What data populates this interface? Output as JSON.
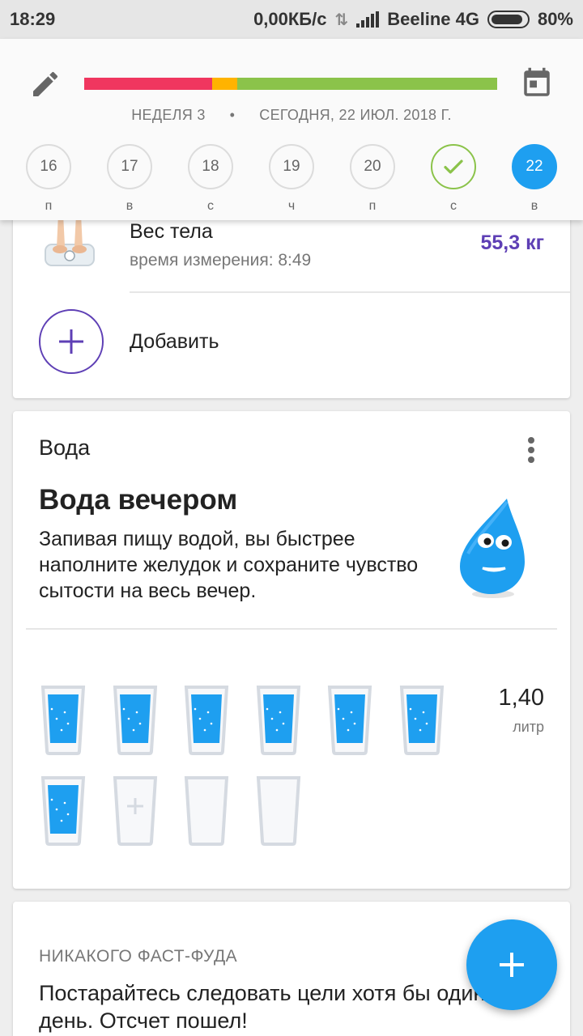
{
  "status_bar": {
    "time": "18:29",
    "net_speed": "0,00КБ/с",
    "carrier": "Beeline 4G",
    "battery": "80%"
  },
  "header": {
    "progress_segments": [
      {
        "fraction": 0.31,
        "color": "#f0365f"
      },
      {
        "fraction": 0.06,
        "color": "#ffb300"
      },
      {
        "fraction": 0.63,
        "color": "#8bc34a"
      }
    ],
    "week_label": "НЕДЕЛЯ 3",
    "separator": "•",
    "date_label": "СЕГОДНЯ, 22 ИЮЛ. 2018 Г.",
    "days": [
      {
        "num": "16",
        "wd": "п",
        "state": "normal"
      },
      {
        "num": "17",
        "wd": "в",
        "state": "normal"
      },
      {
        "num": "18",
        "wd": "с",
        "state": "normal"
      },
      {
        "num": "19",
        "wd": "ч",
        "state": "normal"
      },
      {
        "num": "20",
        "wd": "п",
        "state": "normal"
      },
      {
        "num": "",
        "wd": "с",
        "state": "done"
      },
      {
        "num": "22",
        "wd": "в",
        "state": "today"
      }
    ]
  },
  "weight_card": {
    "title": "Вес тела",
    "subtitle": "время измерения: 8:49",
    "value": "55,3 кг",
    "add_label": "Добавить"
  },
  "water_card": {
    "title": "Вода",
    "tip_title": "Вода вечером",
    "tip_text": "Запивая пищу водой, вы быстрее наполните желудок и сохраните чувство сытости на весь вечер.",
    "glasses": [
      "filled",
      "filled",
      "filled",
      "filled",
      "filled",
      "filled",
      "filled",
      "add",
      "empty",
      "empty"
    ],
    "amount": "1,40",
    "unit": "литр"
  },
  "fastfood_card": {
    "title": "НИКАКОГО ФАСТ-ФУДА",
    "text": "Постарайтесь следовать цели хотя бы один день. Отсчет пошел!"
  },
  "colors": {
    "accent_purple": "#5e3fb5",
    "accent_blue": "#1e9ff0",
    "check_green": "#8bc34a"
  }
}
